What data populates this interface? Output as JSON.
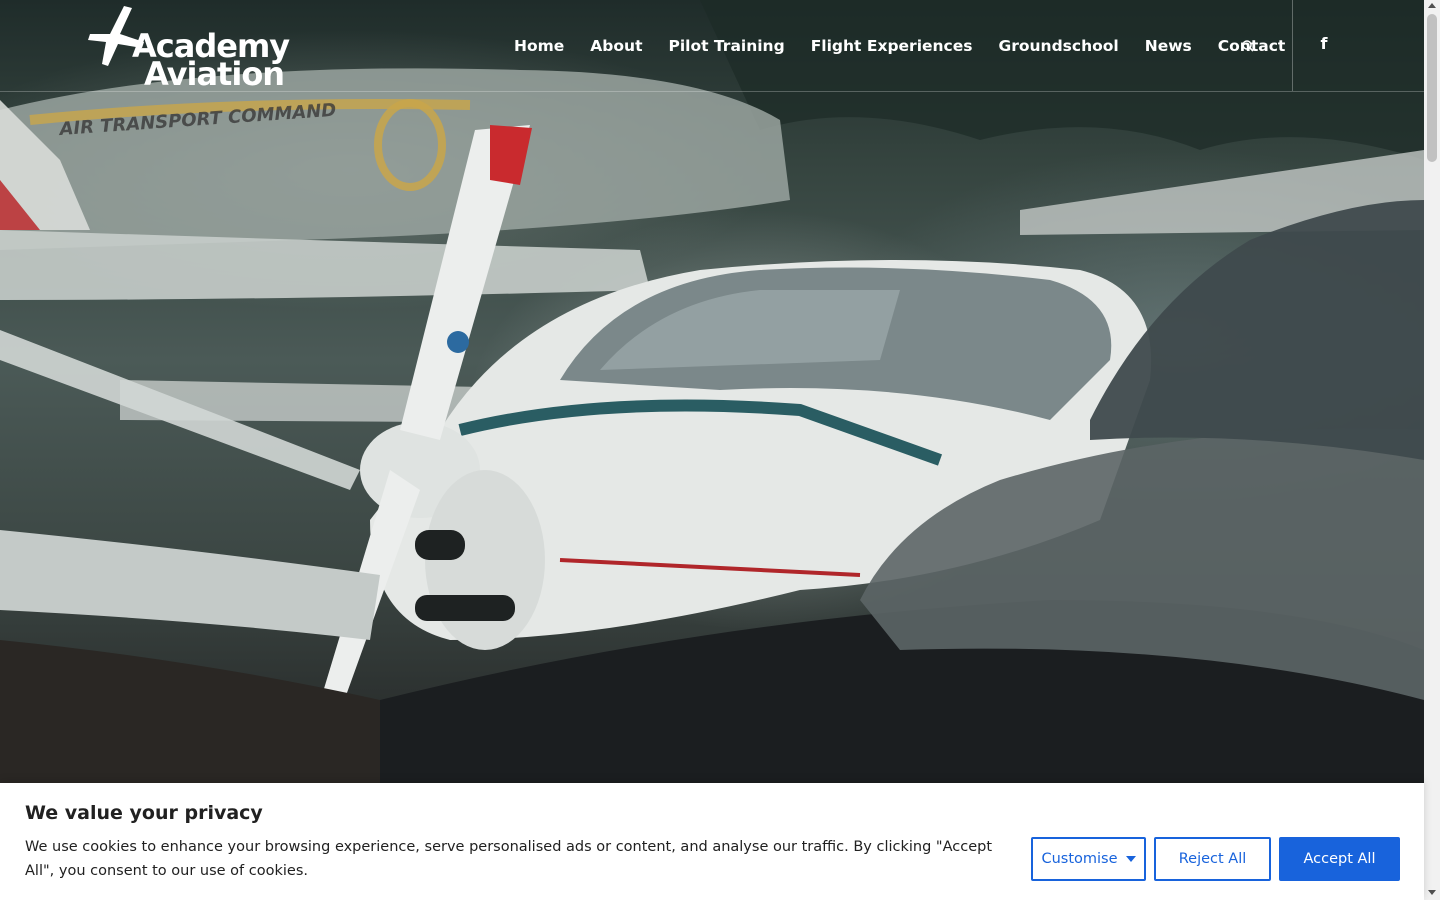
{
  "header": {
    "logo_line1": "Academy",
    "logo_line2": "Aviation",
    "nav": [
      {
        "label": "Home"
      },
      {
        "label": "About"
      },
      {
        "label": "Pilot Training"
      },
      {
        "label": "Flight Experiences"
      },
      {
        "label": "Groundschool"
      },
      {
        "label": "News"
      },
      {
        "label": "Contact"
      }
    ],
    "search_icon": "search-icon",
    "social_icon": "facebook-icon",
    "social_label": "f"
  },
  "hero": {
    "aircraft_fuselage_text": "AIR TRANSPORT COMMAND"
  },
  "cookie_banner": {
    "title": "We value your privacy",
    "text": "We use cookies to enhance your browsing experience, serve personalised ads or content, and analyse our traffic. By clicking \"Accept All\", you consent to our use of cookies.",
    "customise_label": "Customise",
    "reject_label": "Reject All",
    "accept_label": "Accept All",
    "accent_color": "#1863dc"
  }
}
